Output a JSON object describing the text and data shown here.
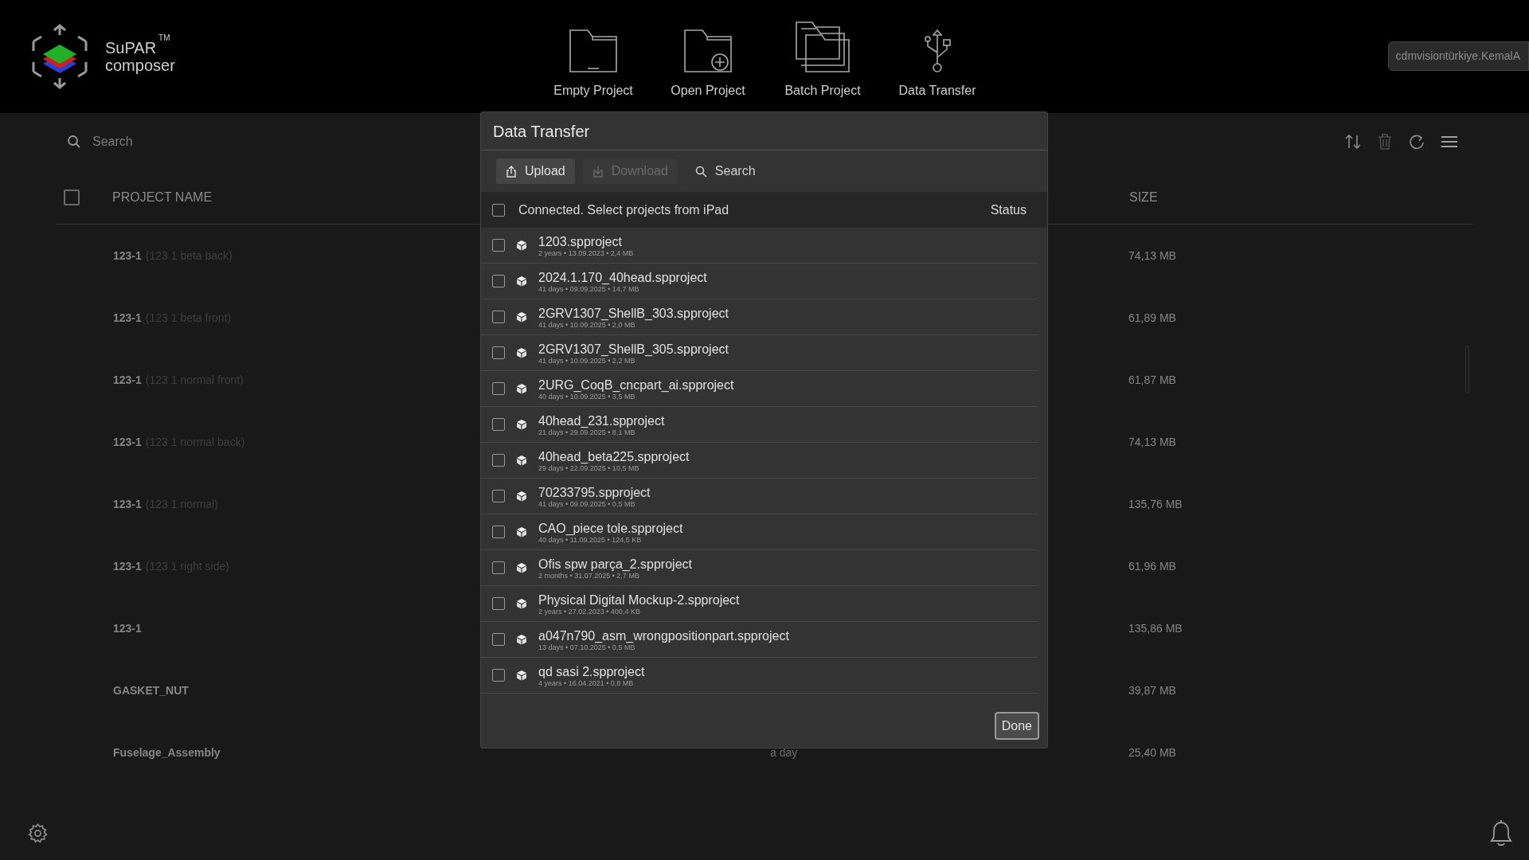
{
  "header": {
    "brand": "SuPAR",
    "trademark": "TM",
    "product": "composer",
    "actions": [
      {
        "label": "Empty Project",
        "kind": "empty"
      },
      {
        "label": "Open Project",
        "kind": "open"
      },
      {
        "label": "Batch Project",
        "kind": "batch"
      },
      {
        "label": "Data Transfer",
        "kind": "transfer"
      }
    ],
    "user": "cdmvisiontürkiye.KemalA"
  },
  "projects": {
    "search_placeholder": "Search",
    "select_all_checked": false,
    "columns": {
      "name": "PROJECT NAME",
      "size": "SIZE"
    },
    "rows": [
      {
        "name": "123-1",
        "detail": "(123 1 beta back)",
        "size": "74,13 MB"
      },
      {
        "name": "123-1",
        "detail": "(123 1 beta front)",
        "size": "61,89 MB"
      },
      {
        "name": "123-1",
        "detail": "(123 1 normal front)",
        "size": "61,87 MB"
      },
      {
        "name": "123-1",
        "detail": "(123 1 normal back)",
        "size": "74,13 MB"
      },
      {
        "name": "123-1",
        "detail": "(123 1 normal)",
        "size": "135,76 MB"
      },
      {
        "name": "123-1",
        "detail": "(123 1 right side)",
        "size": "61,96 MB"
      },
      {
        "name": "123-1",
        "size": "135,86 MB"
      },
      {
        "name": "GASKET_NUT",
        "size": "39,87 MB"
      },
      {
        "name": "Fuselage_Assembly",
        "modified": "a day",
        "size": "25,40 MB"
      }
    ]
  },
  "dialog": {
    "title": "Data Transfer",
    "tabs": [
      {
        "label": "Upload",
        "kind": "upload",
        "selected": true,
        "disabled": false
      },
      {
        "label": "Download",
        "kind": "download",
        "selected": false,
        "disabled": true
      },
      {
        "label": "Search",
        "kind": "search",
        "selected": false,
        "disabled": false
      }
    ],
    "list_header": {
      "checked": false,
      "label": "Connected. Select projects from iPad",
      "status": "Status"
    },
    "files": [
      {
        "name": "1203.spproject",
        "meta": "2 years • 13.09.2023 • 2,4 MB",
        "checked": false
      },
      {
        "name": "2024.1.170_40head.spproject",
        "meta": "41 days • 09.09.2025 • 14,7 MB",
        "checked": false
      },
      {
        "name": "2GRV1307_ShellB_303.spproject",
        "meta": "41 days • 10.09.2025 • 2,0 MB",
        "checked": false
      },
      {
        "name": "2GRV1307_ShellB_305.spproject",
        "meta": "41 days • 10.09.2025 • 2,2 MB",
        "checked": false
      },
      {
        "name": "2URG_CoqB_cncpart_ai.spproject",
        "meta": "40 days • 10.09.2025 • 3,5 MB",
        "checked": false
      },
      {
        "name": "40head_231.spproject",
        "meta": "21 days • 29.09.2025 • 8,1 MB",
        "checked": false
      },
      {
        "name": "40head_beta225.spproject",
        "meta": "29 days • 22.09.2025 • 10,5 MB",
        "checked": false
      },
      {
        "name": "70233795.spproject",
        "meta": "41 days • 09.09.2025 • 0,5 MB",
        "checked": false
      },
      {
        "name": "CAO_piece tole.spproject",
        "meta": "40 days • 11.09.2025 • 124,5 KB",
        "checked": false
      },
      {
        "name": "Ofis spw parça_2.spproject",
        "meta": "2 months • 31.07.2025 • 2,7 MB",
        "checked": false
      },
      {
        "name": "Physical Digital Mockup-2.spproject",
        "meta": "2 years • 27.02.2023 • 400,4 KB",
        "checked": false
      },
      {
        "name": "a047n790_asm_wrongpositionpart.spproject",
        "meta": "13 days • 07.10.2025 • 0,5 MB",
        "checked": false
      },
      {
        "name": "qd sasi 2.spproject",
        "meta": "4 years • 16.04.2021 • 0,8 MB",
        "checked": false
      }
    ],
    "done": "Done"
  }
}
